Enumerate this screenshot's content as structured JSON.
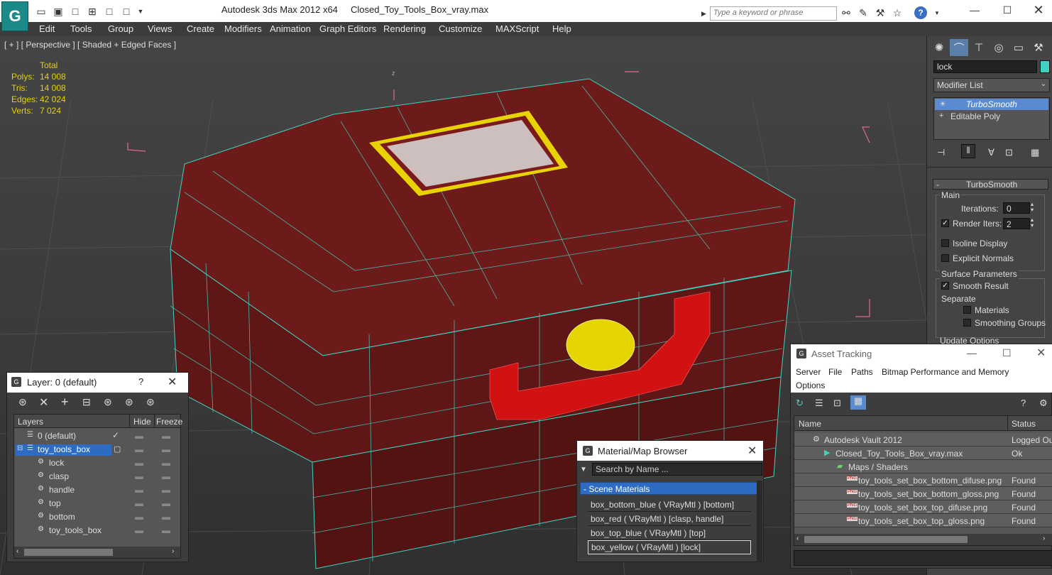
{
  "titlebar": {
    "app_name": "Autodesk 3ds Max  2012 x64",
    "file_name": "Closed_Toy_Tools_Box_vray.max",
    "search_placeholder": "Type a keyword or phrase",
    "logo_icon": "3dsmax-logo-icon",
    "quick_access": [
      "open-icon",
      "save-icon",
      "new-icon",
      "project-icon",
      "undo-icon",
      "redo-icon"
    ]
  },
  "menu": [
    "Edit",
    "Tools",
    "Group",
    "Views",
    "Create",
    "Modifiers",
    "Animation",
    "Graph Editors",
    "Rendering",
    "Customize",
    "MAXScript",
    "Help"
  ],
  "viewport": {
    "label": "[ + ] [ Perspective ] [ Shaded + Edged Faces ]",
    "stats_header": "Total",
    "stats": [
      {
        "name": "Polys:",
        "value": "14 008"
      },
      {
        "name": "Tris:",
        "value": "14 008"
      },
      {
        "name": "Edges:",
        "value": "42 024"
      },
      {
        "name": "Verts:",
        "value": "7 024"
      }
    ],
    "axis_label": "z",
    "colors": {
      "box": "#7a1a1a",
      "wire": "#3fd3c0",
      "handle": "#d21212",
      "lock": "#e5d500",
      "bbox": "#e06a8a"
    }
  },
  "command_panel": {
    "object_name": "lock",
    "modifier_list": "Modifier List",
    "stack": [
      {
        "label": "TurboSmooth",
        "selected": true
      },
      {
        "label": "Editable Poly",
        "selected": false
      }
    ],
    "rollout_title": "TurboSmooth",
    "main_label": "Main",
    "iterations_label": "Iterations:",
    "iterations_value": "0",
    "render_iters_label": "Render Iters:",
    "render_iters_value": "2",
    "isoline_label": "Isoline Display",
    "explicit_normals_label": "Explicit Normals",
    "surface_params_label": "Surface Parameters",
    "smooth_result_label": "Smooth Result",
    "separate_label": "Separate",
    "materials_label": "Materials",
    "smoothing_groups_label": "Smoothing Groups",
    "update_options_label": "Update Options"
  },
  "layer_window": {
    "title": "Layer: 0 (default)",
    "help": "?",
    "col_layers": "Layers",
    "col_hide": "Hide",
    "col_freeze": "Freeze",
    "rows": [
      {
        "label": "0 (default)",
        "indent": 1
      },
      {
        "label": "toy_tools_box",
        "indent": 1,
        "selected": true
      },
      {
        "label": "lock",
        "indent": 2
      },
      {
        "label": "clasp",
        "indent": 2
      },
      {
        "label": "handle",
        "indent": 2
      },
      {
        "label": "top",
        "indent": 2
      },
      {
        "label": "bottom",
        "indent": 2
      },
      {
        "label": "toy_tools_box",
        "indent": 2
      }
    ]
  },
  "material_browser": {
    "title": "Material/Map Browser",
    "search_placeholder": "Search by Name ...",
    "group": "- Scene Materials",
    "items": [
      "box_bottom_blue  ( VRayMtl )  [bottom]",
      "box_red  ( VRayMtl )  [clasp, handle]",
      "box_top_blue  ( VRayMtl )  [top]",
      "box_yellow  ( VRayMtl )  [lock]"
    ]
  },
  "asset_tracking": {
    "title": "Asset Tracking",
    "menu": [
      "Server",
      "File",
      "Paths",
      "Bitmap Performance and Memory",
      "Options"
    ],
    "col_name": "Name",
    "col_status": "Status",
    "rows": [
      {
        "name": "Autodesk Vault 2012",
        "status": "Logged Ou",
        "indent": 1,
        "icon": "vault-icon"
      },
      {
        "name": "Closed_Toy_Tools_Box_vray.max",
        "status": "Ok",
        "indent": 2,
        "icon": "max-file-icon"
      },
      {
        "name": "Maps / Shaders",
        "status": "",
        "indent": 3,
        "icon": "maps-icon"
      },
      {
        "name": "toy_tools_set_box_bottom_difuse.png",
        "status": "Found",
        "indent": 4,
        "icon": "png-icon"
      },
      {
        "name": "toy_tools_set_box_bottom_gloss.png",
        "status": "Found",
        "indent": 4,
        "icon": "png-icon"
      },
      {
        "name": "toy_tools_set_box_top_difuse.png",
        "status": "Found",
        "indent": 4,
        "icon": "png-icon"
      },
      {
        "name": "toy_tools_set_box_top_gloss.png",
        "status": "Found",
        "indent": 4,
        "icon": "png-icon"
      }
    ]
  }
}
